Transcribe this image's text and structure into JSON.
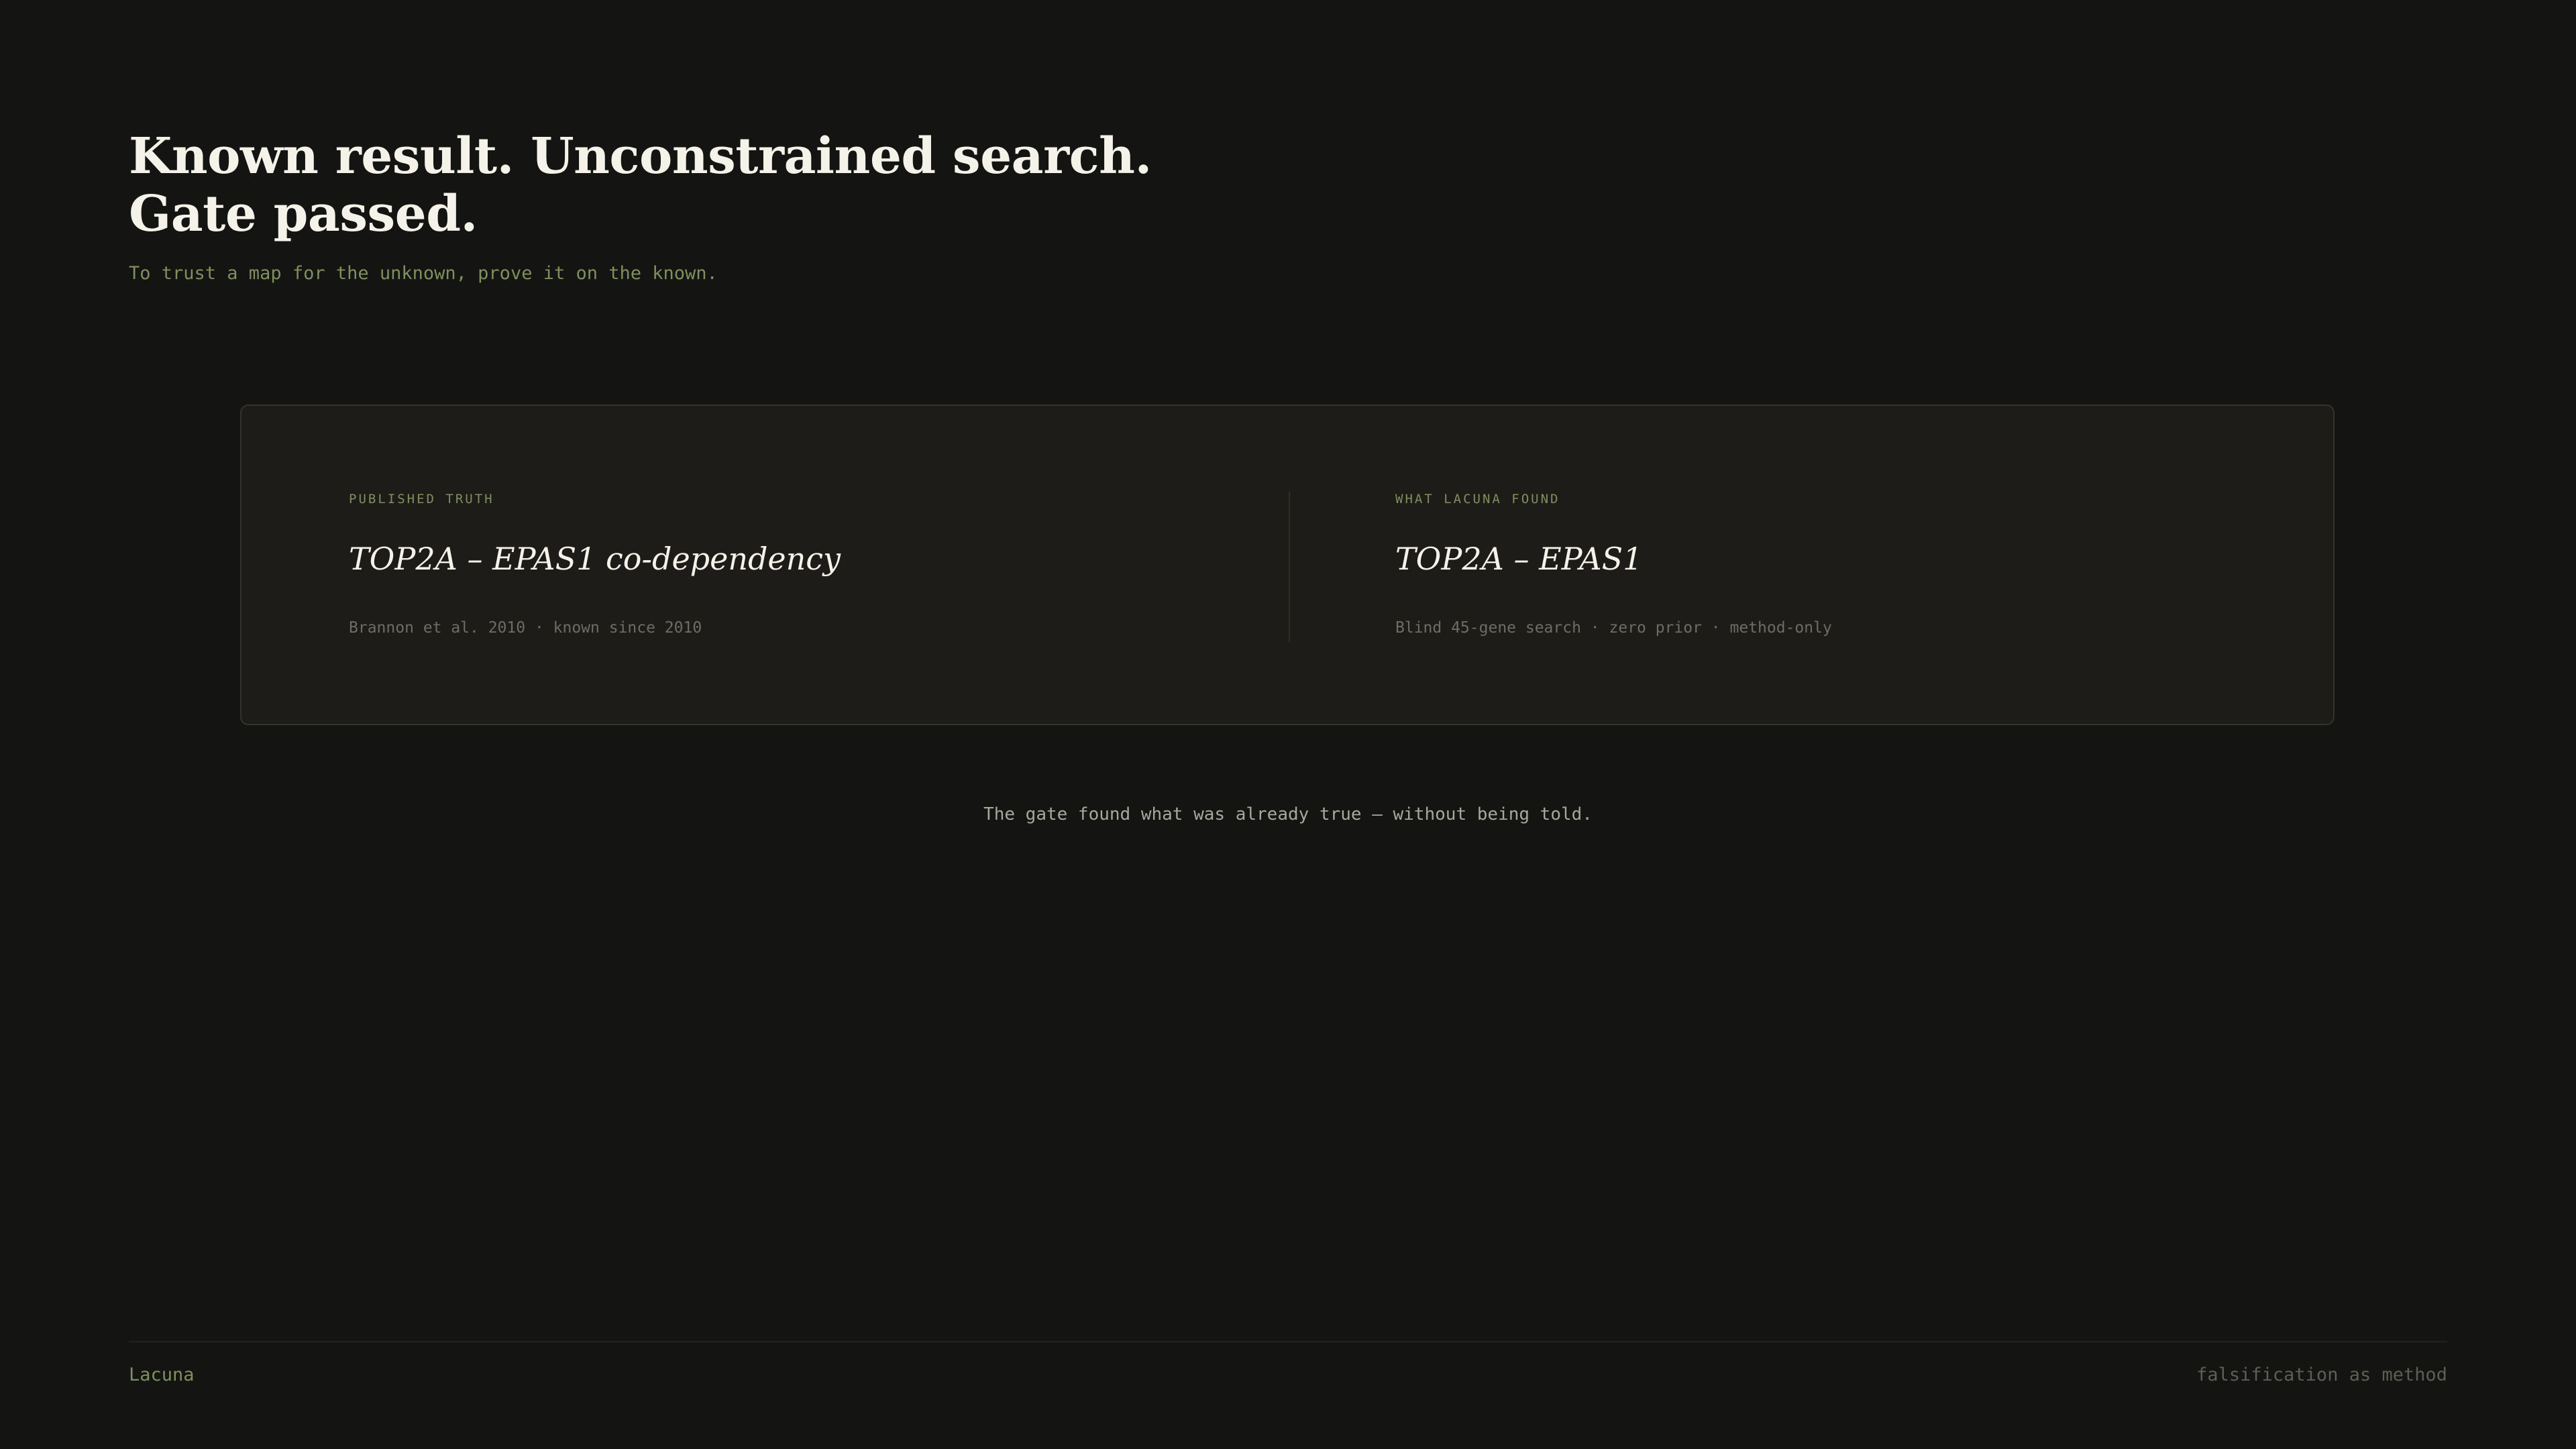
{
  "header": {
    "title": "Known result. Unconstrained search. Gate passed.",
    "subtitle": "To trust a map for the unknown, prove it on the known."
  },
  "comparison": {
    "left": {
      "eyebrow": "PUBLISHED TRUTH",
      "pair": "TOP2A – EPAS1 co-dependency",
      "meta": "Brannon et al. 2010 · known since 2010"
    },
    "right": {
      "eyebrow": "WHAT LACUNA FOUND",
      "pair": "TOP2A – EPAS1",
      "meta": "Blind 45-gene search · zero prior · method-only"
    }
  },
  "caption": "The gate found what was already true — without being told.",
  "footer": {
    "brand": "Lacuna",
    "tagline": "falsification as method"
  },
  "colors": {
    "background": "#141412",
    "card": "#1d1c18",
    "accent": "#7f8f5e",
    "text": "#f5f2ea",
    "muted": "#6e6c64"
  }
}
